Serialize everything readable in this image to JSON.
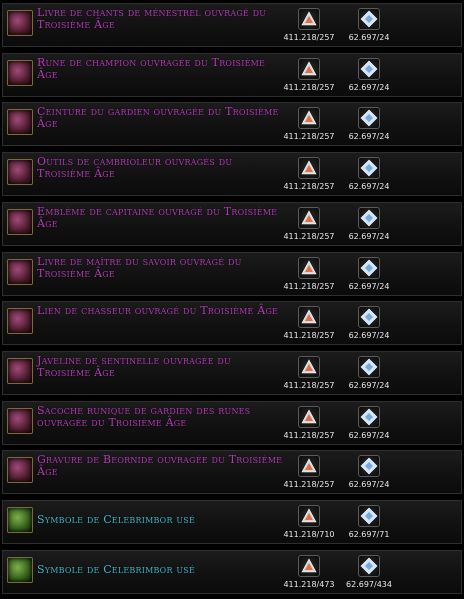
{
  "currency_a_icon": "triangle-shard-icon",
  "currency_b_icon": "diamond-mark-icon",
  "colors": {
    "incomparable": "#b43cb8",
    "legendary": "#3fb6c8",
    "cost": "#e8e8e8"
  },
  "rows": [
    {
      "name": "Livre de chants de ménestrel ouvragé du Troisième Âge",
      "icon": "songbook-icon",
      "cost_a": "411.218/257",
      "cost_b": "62.697/24"
    },
    {
      "name": "Rune de champion ouvragée du Troisième Âge",
      "icon": "rune-icon",
      "cost_a": "411.218/257",
      "cost_b": "62.697/24"
    },
    {
      "name": "Ceinture du gardien ouvragée du Troisième Âge",
      "icon": "belt-icon",
      "cost_a": "411.218/257",
      "cost_b": "62.697/24"
    },
    {
      "name": "Outils de cambrioleur ouvragés du Troisième Âge",
      "icon": "tools-icon",
      "cost_a": "411.218/257",
      "cost_b": "62.697/24"
    },
    {
      "name": "Emblème de capitaine ouvragé du Troisième Âge",
      "icon": "emblem-icon",
      "cost_a": "411.218/257",
      "cost_b": "62.697/24"
    },
    {
      "name": "Livre de maître du savoir ouvragé du Troisième Âge",
      "icon": "lore-book-icon",
      "cost_a": "411.218/257",
      "cost_b": "62.697/24"
    },
    {
      "name": "Lien de chasseur ouvragé du Troisième Âge",
      "icon": "hunter-link-icon",
      "cost_a": "411.218/257",
      "cost_b": "62.697/24"
    },
    {
      "name": "Javeline de sentinelle ouvragée du Troisième Âge",
      "icon": "javelin-icon",
      "cost_a": "411.218/257",
      "cost_b": "62.697/24"
    },
    {
      "name": "Sacoche runique de gardien des runes ouvragée du Troisième Âge",
      "icon": "satchel-icon",
      "cost_a": "411.218/257",
      "cost_b": "62.697/24"
    },
    {
      "name": "Gravure de Beornide ouvragée du Troisième Âge",
      "icon": "carving-icon",
      "cost_a": "411.218/257",
      "cost_b": "62.697/24"
    },
    {
      "name": "Symbole de Celebrimbor usé",
      "icon": "symbol-icon",
      "cost_a": "411.218/710",
      "cost_b": "62.697/71"
    },
    {
      "name": "Symbole de Celebrimbor usé",
      "icon": "symbol-icon",
      "cost_a": "411.218/473",
      "cost_b": "62.697/434"
    }
  ]
}
